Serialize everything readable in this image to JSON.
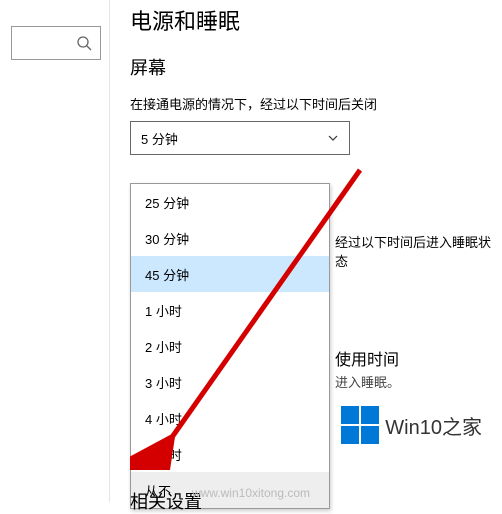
{
  "page_title": "电源和睡眠",
  "section_screen": "屏幕",
  "screen_off_label": "在接通电源的情况下，经过以下时间后关闭",
  "screen_off_value": "5 分钟",
  "dropdown_options": [
    "25 分钟",
    "30 分钟",
    "45 分钟",
    "1 小时",
    "2 小时",
    "3 小时",
    "4 小时",
    "5 小时",
    "从不"
  ],
  "highlighted_index": 2,
  "hover_index": 8,
  "sleep_label_partial": "经过以下时间后进入睡眠状态",
  "usage_time_heading": "使用时间",
  "usage_time_text": "进入睡眠。",
  "related_settings": "相关设置",
  "logo_text": "Win10之家",
  "watermark": "www.win10xitong.com"
}
